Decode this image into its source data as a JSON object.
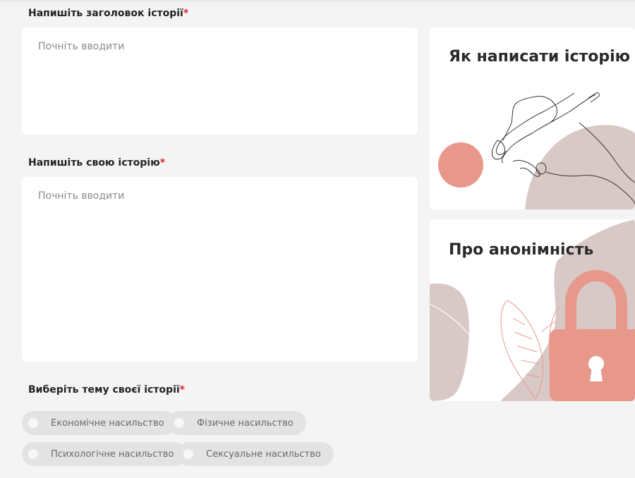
{
  "form": {
    "title_label": "Напишіть заголовок історії",
    "title_placeholder": "Почніть вводити",
    "story_label": "Напишіть свою історію",
    "story_placeholder": "Почніть вводити",
    "topic_label": "Виберіть тему своєї історії",
    "required_mark": "*",
    "topics": [
      {
        "label": "Економічне насильство"
      },
      {
        "label": "Фізичне насильство"
      },
      {
        "label": "Психологічне насильство"
      },
      {
        "label": "Сексуальне насильство"
      }
    ]
  },
  "cards": {
    "how_to": {
      "title": "Як написати історію"
    },
    "anonymity": {
      "title": "Про анонімність"
    }
  },
  "colors": {
    "accent": "#e8988a",
    "blob": "#d9c9c6",
    "required": "#e0222e"
  }
}
